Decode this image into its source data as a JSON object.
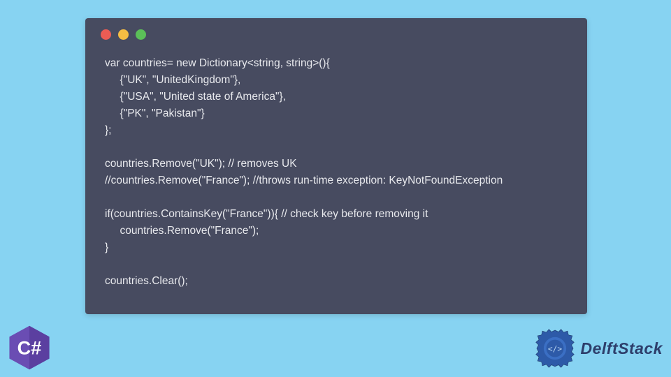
{
  "code": {
    "line1": "var countries= new Dictionary<string, string>(){",
    "line2": "     {\"UK\", \"UnitedKingdom\"},",
    "line3": "     {\"USA\", \"United state of America\"},",
    "line4": "     {\"PK\", \"Pakistan\"}",
    "line5": "};",
    "line6": "",
    "line7": "countries.Remove(\"UK\"); // removes UK",
    "line8": "//countries.Remove(\"France\"); //throws run-time exception: KeyNotFoundException",
    "line9": "",
    "line10": "if(countries.ContainsKey(\"France\")){ // check key before removing it",
    "line11": "     countries.Remove(\"France\");",
    "line12": "}",
    "line13": "",
    "line14": "countries.Clear();"
  },
  "logos": {
    "csharp_label": "C#",
    "delft_label": "DelftStack"
  },
  "colors": {
    "page_bg": "#87d3f2",
    "code_bg": "#474b60",
    "code_fg": "#e8e9ed",
    "dot_red": "#ec5c54",
    "dot_yellow": "#f5bd43",
    "dot_green": "#5bbf58",
    "csharp_purple": "#6a4db3",
    "delft_blue": "#2d3e6b"
  }
}
